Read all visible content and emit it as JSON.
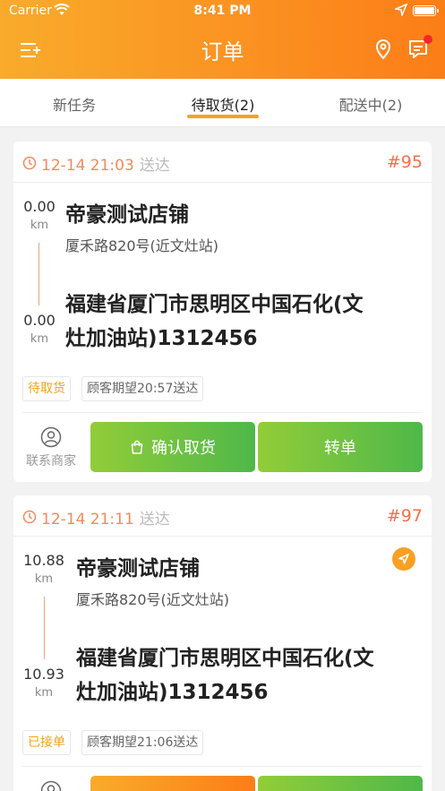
{
  "status_bar": {
    "carrier": "Carrier",
    "time": "8:41 PM"
  },
  "nav": {
    "title": "订单"
  },
  "tabs": [
    {
      "label": "新任务"
    },
    {
      "label": "待取货(2)"
    },
    {
      "label": "配送中(2)"
    }
  ],
  "orders": [
    {
      "time": "12-14 21:03",
      "time_suffix": "送达",
      "number": "#95",
      "shop_distance": "0.00",
      "dest_distance": "0.00",
      "unit": "km",
      "shop_name": "帝豪测试店铺",
      "shop_address": "厦禾路820号(近文灶站)",
      "dest_line1": "福建省厦门市思明区中国石化(文",
      "dest_line2": "灶加油站)1312456",
      "status_tag": "待取货",
      "expect_tag": "顾客期望20:57送达",
      "contact_label": "联系商家",
      "primary_button": "确认取货",
      "secondary_button": "转单"
    },
    {
      "time": "12-14 21:11",
      "time_suffix": "送达",
      "number": "#97",
      "shop_distance": "10.88",
      "dest_distance": "10.93",
      "unit": "km",
      "shop_name": "帝豪测试店铺",
      "shop_address": "厦禾路820号(近文灶站)",
      "dest_line1": "福建省厦门市思明区中国石化(文",
      "dest_line2": "灶加油站)1312456",
      "status_tag": "已接单",
      "expect_tag": "顾客期望21:06送达"
    }
  ],
  "colors": {
    "header_start": "#f9ab2b",
    "header_end": "#fc7d16",
    "accent": "#f7a21c",
    "order_number": "#f2704c",
    "button_green": "#5cbc46"
  }
}
